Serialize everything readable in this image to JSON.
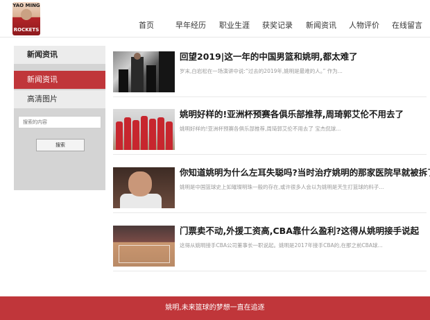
{
  "logo": {
    "line1": "YAO MING",
    "line2": "ROCKETS"
  },
  "nav": {
    "items": [
      {
        "label": "首页"
      },
      {
        "label": "早年经历"
      },
      {
        "label": "职业生涯"
      },
      {
        "label": "获奖记录"
      },
      {
        "label": "新闻资讯"
      },
      {
        "label": "人物评价"
      },
      {
        "label": "在线留言"
      }
    ]
  },
  "sidebar": {
    "title": "新闻资讯",
    "items": [
      {
        "label": "新闻资讯",
        "active": true
      },
      {
        "label": "高清图片",
        "active": false
      }
    ],
    "search": {
      "placeholder": "搜索的内容",
      "button_label": "搜索"
    }
  },
  "news": [
    {
      "title": "回望2019|这一年的中国男篮和姚明,都太难了",
      "desc": "岁末,白岩松在一场演讲中说:“过去的2019年,姚明是最难的人。” 作为..."
    },
    {
      "title": "姚明好样的!亚洲杯预赛各俱乐部推荐,周琦郭艾伦不用去了",
      "desc": "姚明好样的!亚洲杯预赛各俱乐部推荐,周琦郭艾伦不用去了 宝杰侃球..."
    },
    {
      "title": "你知道姚明为什么左耳失聪吗?当时治疗姚明的那家医院早就被拆了",
      "desc": "姚明是中国篮球史上如璀璨明珠一般的存在,或许很多人会以为姚明是天生打篮球的料子..."
    },
    {
      "title": "门票卖不动,外援工资高,CBA靠什么盈利?这得从姚明接手说起",
      "desc": "这得从姚明接手CBA公司董事长一职说起。姚明是2017年接手CBA的,在那之前CBA球..."
    }
  ],
  "colors": {
    "accent": "#c0363a",
    "sidebar_bg": "#d4d4d4",
    "footer_bg": "#c0363a"
  },
  "footer": {
    "text": "姚明,未来篮球的梦想一直在追逐"
  }
}
